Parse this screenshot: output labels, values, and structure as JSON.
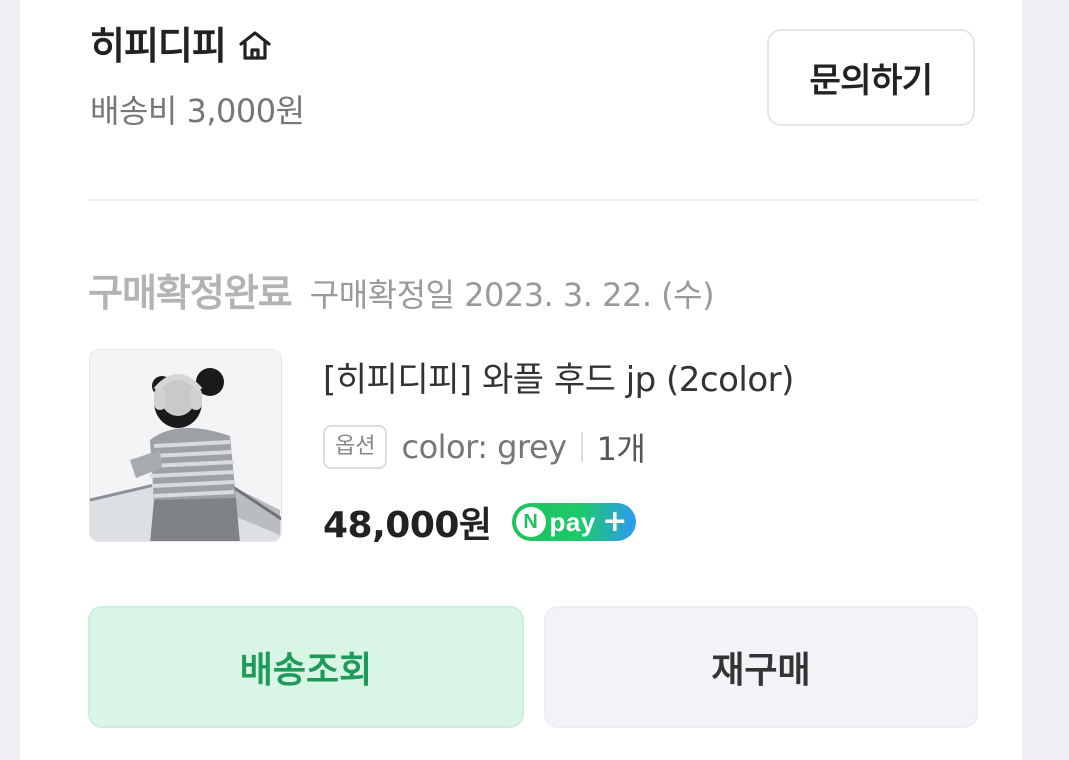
{
  "store": {
    "name": "히피디피",
    "shipping_fee": "배송비 3,000원",
    "home_icon": "home-icon",
    "inquiry_label": "문의하기"
  },
  "order": {
    "status": "구매확정완료",
    "confirm_date": "구매확정일 2023. 3. 22. (수)",
    "product": {
      "name": "[히피디피] 와플 후드 jp (2color)",
      "option_badge": "옵션",
      "option_value": "color: grey",
      "quantity": "1개",
      "price": "48,000원",
      "pay_badge": {
        "icon": "naver-pay-plus-icon",
        "n": "N",
        "text": "pay",
        "plus": "+",
        "colors": {
          "start": "#1fc35b",
          "end": "#2b9bf0"
        }
      }
    }
  },
  "actions": {
    "track_label": "배송조회",
    "rebuy_label": "재구매"
  },
  "colors": {
    "accent_green": "#1e9b58",
    "track_bg": "#d9f5e6",
    "rebuy_bg": "#f2f3f6"
  }
}
